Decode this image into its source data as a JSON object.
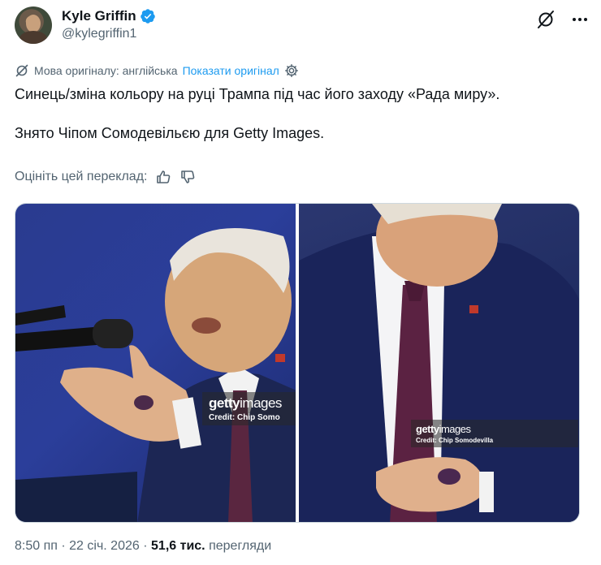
{
  "author": {
    "display_name": "Kyle Griffin",
    "handle": "@kylegriffin1",
    "verified": true
  },
  "translation": {
    "language_note": "Мова оригіналу: англійська",
    "show_original": "Показати оригінал"
  },
  "tweet": {
    "paragraphs": [
      "Синець/зміна кольору на руці Трампа під час його заходу «Рада миру».",
      "Знято Чіпом Сомодевільєю для Getty Images."
    ]
  },
  "rate_translation": {
    "label": "Оцініть цей переклад:"
  },
  "media": {
    "photos": [
      {
        "watermark_brand": "getty",
        "watermark_brand_suffix": "images",
        "credit": "Credit: Chip Somo"
      },
      {
        "watermark_brand": "getty",
        "watermark_brand_suffix": "images",
        "credit": "Credit: Chip Somodevilla"
      }
    ]
  },
  "meta": {
    "time": "8:50 пп",
    "date": "22 січ. 2026",
    "views_count": "51,6 тис.",
    "views_label": "перегляди",
    "separator": "·"
  },
  "colors": {
    "accent": "#1d9bf0",
    "secondary_text": "#536471",
    "primary_text": "#0f1419"
  }
}
